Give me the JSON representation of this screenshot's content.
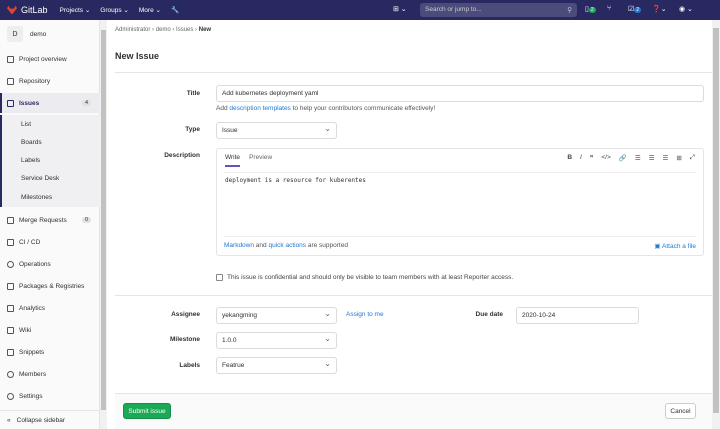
{
  "nav": {
    "brand": "GitLab",
    "projects": "Projects",
    "groups": "Groups",
    "more": "More",
    "search_placeholder": "Search or jump to...",
    "todo_count": "2",
    "mr_count": "2"
  },
  "sidebar": {
    "project_initial": "D",
    "project_name": "demo",
    "items": [
      {
        "label": "Project overview"
      },
      {
        "label": "Repository"
      },
      {
        "label": "Issues",
        "count": "4"
      },
      {
        "label": "Merge Requests",
        "count": "0"
      },
      {
        "label": "CI / CD"
      },
      {
        "label": "Operations"
      },
      {
        "label": "Packages & Registries"
      },
      {
        "label": "Analytics"
      },
      {
        "label": "Wiki"
      },
      {
        "label": "Snippets"
      },
      {
        "label": "Members"
      },
      {
        "label": "Settings"
      }
    ],
    "issues_sub": [
      "List",
      "Boards",
      "Labels",
      "Service Desk",
      "Milestones"
    ],
    "collapse": "Collapse sidebar"
  },
  "breadcrumb": [
    "Administrator",
    "demo",
    "Issues",
    "New"
  ],
  "page_title": "New Issue",
  "form": {
    "title_label": "Title",
    "title_value": "Add kubernetes deployment yaml",
    "help_pre": "Add",
    "help_link": "description templates",
    "help_post": "to help your contributors communicate effectively!",
    "type_label": "Type",
    "type_value": "Issue",
    "description_label": "Description",
    "tab_write": "Write",
    "tab_preview": "Preview",
    "description_value": "deployment is a resource for kuberentes",
    "md_link": "Markdown",
    "md_and": "and",
    "qa_link": "quick actions",
    "md_post": "are supported",
    "attach": "Attach a file",
    "confidential": "This issue is confidential and should only be visible to team members with at least Reporter access.",
    "assignee_label": "Assignee",
    "assignee_value": "yekangming",
    "assign_me": "Assign to me",
    "due_label": "Due date",
    "due_value": "2020-10-24",
    "milestone_label": "Milestone",
    "milestone_value": "1.0.0",
    "labels_label": "Labels",
    "labels_value": "Featrue",
    "submit": "Submit issue",
    "cancel": "Cancel"
  }
}
